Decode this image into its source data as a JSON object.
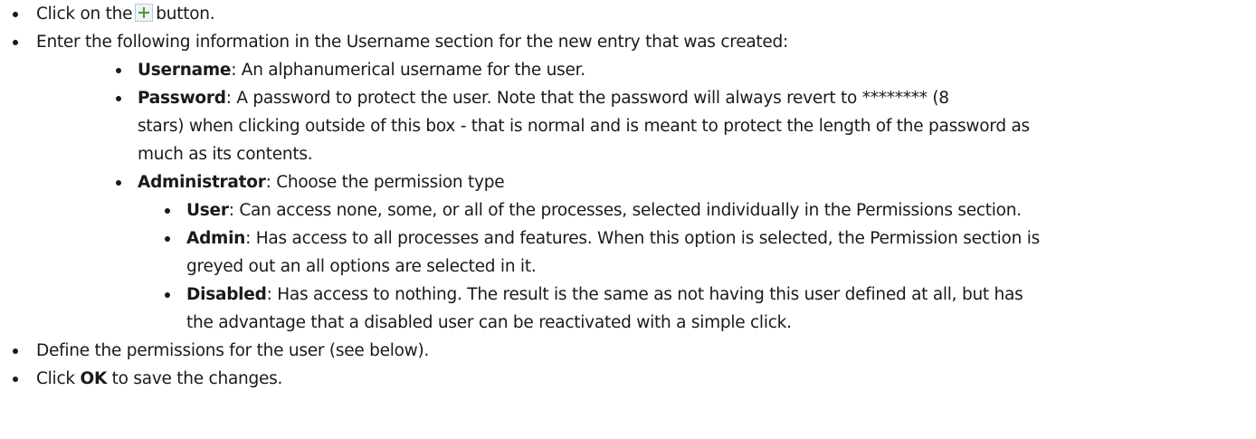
{
  "steps": {
    "step1": {
      "before": "Click on the",
      "icon": "plus-icon",
      "after": "button."
    },
    "step2": {
      "text": "Enter the following information in the Username section for the new entry that was created:",
      "fields": {
        "username": {
          "term": "Username",
          "desc": ": An alphanumerical username for the user."
        },
        "password": {
          "term": "Password",
          "desc_line1": ": A password to protect the user. Note that the password will always revert to ******** (8",
          "desc_line2": "stars) when clicking outside of this box - that is normal and is meant to protect the length of the password as",
          "desc_line3": "much as its contents."
        },
        "administrator": {
          "term": "Administrator",
          "desc": ": Choose the permission type",
          "options": {
            "user": {
              "term": "User",
              "desc": ": Can access none, some, or all of the processes, selected individually in the Permissions section."
            },
            "admin": {
              "term": "Admin",
              "desc_line1": ": Has access to all processes and features. When this option is selected, the Permission section is",
              "desc_line2": "greyed out an all options are selected in it."
            },
            "disabled": {
              "term": "Disabled",
              "desc_line1": ": Has access to nothing. The result is the same as not having this user defined at all, but has",
              "desc_line2": "the advantage that a disabled user can be reactivated with a simple click."
            }
          }
        }
      }
    },
    "step3": {
      "text": "Define the permissions for the user (see below)."
    },
    "step4": {
      "before": "Click ",
      "ok": "OK",
      "after": " to save the changes."
    }
  }
}
